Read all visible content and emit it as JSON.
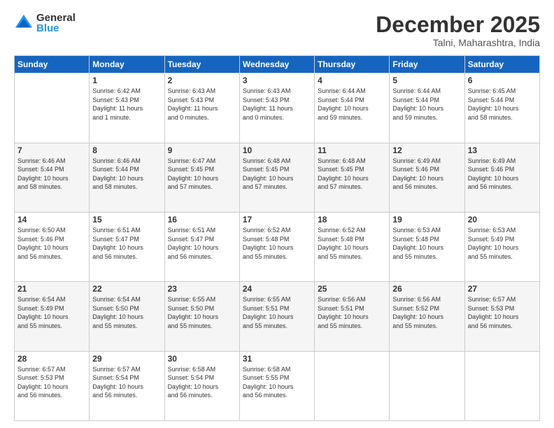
{
  "logo": {
    "general": "General",
    "blue": "Blue"
  },
  "title": "December 2025",
  "subtitle": "Talni, Maharashtra, India",
  "days_of_week": [
    "Sunday",
    "Monday",
    "Tuesday",
    "Wednesday",
    "Thursday",
    "Friday",
    "Saturday"
  ],
  "weeks": [
    [
      {
        "day": "",
        "info": ""
      },
      {
        "day": "1",
        "info": "Sunrise: 6:42 AM\nSunset: 5:43 PM\nDaylight: 11 hours\nand 1 minute."
      },
      {
        "day": "2",
        "info": "Sunrise: 6:43 AM\nSunset: 5:43 PM\nDaylight: 11 hours\nand 0 minutes."
      },
      {
        "day": "3",
        "info": "Sunrise: 6:43 AM\nSunset: 5:43 PM\nDaylight: 11 hours\nand 0 minutes."
      },
      {
        "day": "4",
        "info": "Sunrise: 6:44 AM\nSunset: 5:44 PM\nDaylight: 10 hours\nand 59 minutes."
      },
      {
        "day": "5",
        "info": "Sunrise: 6:44 AM\nSunset: 5:44 PM\nDaylight: 10 hours\nand 59 minutes."
      },
      {
        "day": "6",
        "info": "Sunrise: 6:45 AM\nSunset: 5:44 PM\nDaylight: 10 hours\nand 58 minutes."
      }
    ],
    [
      {
        "day": "7",
        "info": "Sunrise: 6:46 AM\nSunset: 5:44 PM\nDaylight: 10 hours\nand 58 minutes."
      },
      {
        "day": "8",
        "info": "Sunrise: 6:46 AM\nSunset: 5:44 PM\nDaylight: 10 hours\nand 58 minutes."
      },
      {
        "day": "9",
        "info": "Sunrise: 6:47 AM\nSunset: 5:45 PM\nDaylight: 10 hours\nand 57 minutes."
      },
      {
        "day": "10",
        "info": "Sunrise: 6:48 AM\nSunset: 5:45 PM\nDaylight: 10 hours\nand 57 minutes."
      },
      {
        "day": "11",
        "info": "Sunrise: 6:48 AM\nSunset: 5:45 PM\nDaylight: 10 hours\nand 57 minutes."
      },
      {
        "day": "12",
        "info": "Sunrise: 6:49 AM\nSunset: 5:46 PM\nDaylight: 10 hours\nand 56 minutes."
      },
      {
        "day": "13",
        "info": "Sunrise: 6:49 AM\nSunset: 5:46 PM\nDaylight: 10 hours\nand 56 minutes."
      }
    ],
    [
      {
        "day": "14",
        "info": "Sunrise: 6:50 AM\nSunset: 5:46 PM\nDaylight: 10 hours\nand 56 minutes."
      },
      {
        "day": "15",
        "info": "Sunrise: 6:51 AM\nSunset: 5:47 PM\nDaylight: 10 hours\nand 56 minutes."
      },
      {
        "day": "16",
        "info": "Sunrise: 6:51 AM\nSunset: 5:47 PM\nDaylight: 10 hours\nand 56 minutes."
      },
      {
        "day": "17",
        "info": "Sunrise: 6:52 AM\nSunset: 5:48 PM\nDaylight: 10 hours\nand 55 minutes."
      },
      {
        "day": "18",
        "info": "Sunrise: 6:52 AM\nSunset: 5:48 PM\nDaylight: 10 hours\nand 55 minutes."
      },
      {
        "day": "19",
        "info": "Sunrise: 6:53 AM\nSunset: 5:48 PM\nDaylight: 10 hours\nand 55 minutes."
      },
      {
        "day": "20",
        "info": "Sunrise: 6:53 AM\nSunset: 5:49 PM\nDaylight: 10 hours\nand 55 minutes."
      }
    ],
    [
      {
        "day": "21",
        "info": "Sunrise: 6:54 AM\nSunset: 5:49 PM\nDaylight: 10 hours\nand 55 minutes."
      },
      {
        "day": "22",
        "info": "Sunrise: 6:54 AM\nSunset: 5:50 PM\nDaylight: 10 hours\nand 55 minutes."
      },
      {
        "day": "23",
        "info": "Sunrise: 6:55 AM\nSunset: 5:50 PM\nDaylight: 10 hours\nand 55 minutes."
      },
      {
        "day": "24",
        "info": "Sunrise: 6:55 AM\nSunset: 5:51 PM\nDaylight: 10 hours\nand 55 minutes."
      },
      {
        "day": "25",
        "info": "Sunrise: 6:56 AM\nSunset: 5:51 PM\nDaylight: 10 hours\nand 55 minutes."
      },
      {
        "day": "26",
        "info": "Sunrise: 6:56 AM\nSunset: 5:52 PM\nDaylight: 10 hours\nand 55 minutes."
      },
      {
        "day": "27",
        "info": "Sunrise: 6:57 AM\nSunset: 5:53 PM\nDaylight: 10 hours\nand 56 minutes."
      }
    ],
    [
      {
        "day": "28",
        "info": "Sunrise: 6:57 AM\nSunset: 5:53 PM\nDaylight: 10 hours\nand 56 minutes."
      },
      {
        "day": "29",
        "info": "Sunrise: 6:57 AM\nSunset: 5:54 PM\nDaylight: 10 hours\nand 56 minutes."
      },
      {
        "day": "30",
        "info": "Sunrise: 6:58 AM\nSunset: 5:54 PM\nDaylight: 10 hours\nand 56 minutes."
      },
      {
        "day": "31",
        "info": "Sunrise: 6:58 AM\nSunset: 5:55 PM\nDaylight: 10 hours\nand 56 minutes."
      },
      {
        "day": "",
        "info": ""
      },
      {
        "day": "",
        "info": ""
      },
      {
        "day": "",
        "info": ""
      }
    ]
  ]
}
